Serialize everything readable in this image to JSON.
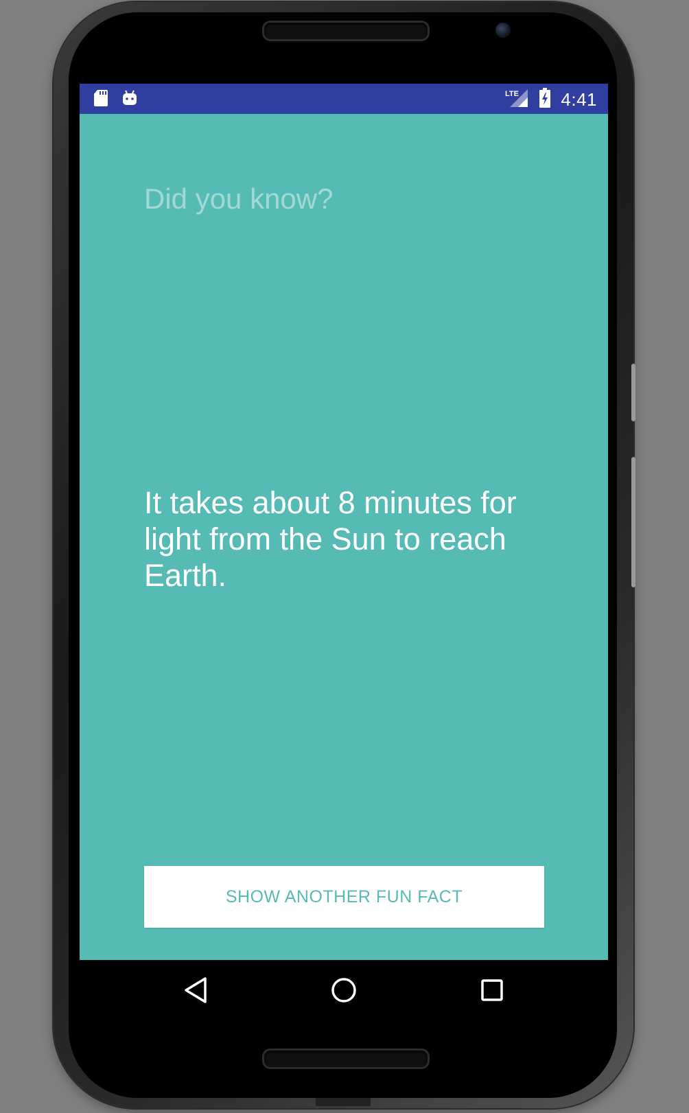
{
  "status_bar": {
    "time": "4:41",
    "network_label": "LTE",
    "notification_icons": [
      "sd-card-icon",
      "android-debug-icon"
    ],
    "system_icons": [
      "lte-signal-icon",
      "battery-charging-icon"
    ],
    "background_color": "#303f9f"
  },
  "app": {
    "background_color": "#55bbb4",
    "header_label": "Did you know?",
    "fact_text": "It takes about 8 minutes for light from the Sun to reach Earth.",
    "button_label": "SHOW ANOTHER FUN FACT",
    "button_text_color": "#55bbb4"
  },
  "nav_bar": {
    "items": [
      {
        "icon": "back-triangle-icon"
      },
      {
        "icon": "home-circle-icon"
      },
      {
        "icon": "recents-square-icon"
      }
    ]
  }
}
